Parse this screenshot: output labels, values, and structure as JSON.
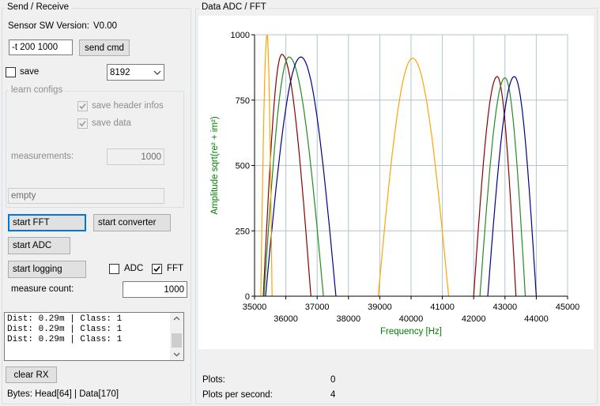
{
  "send_receive": {
    "group_title": "Send / Receive",
    "sensor_sw_label": "Sensor SW Version:",
    "sensor_sw_value": "V0.00",
    "cmd_input_value": "-t 200 1000",
    "send_cmd_label": "send cmd",
    "save_label": "save",
    "save_checked": false,
    "buffer_select_value": "8192",
    "learn_configs": {
      "title": "learn configs",
      "save_header_label": "save header infos",
      "save_header_checked": true,
      "save_data_label": "save data",
      "save_data_checked": true,
      "measurements_label": "measurements:",
      "measurements_value": "1000",
      "status_field_value": "empty"
    },
    "start_fft_label": "start FFT",
    "start_converter_label": "start converter",
    "start_adc_label": "start ADC",
    "start_logging_label": "start logging",
    "adc_label": "ADC",
    "adc_checked": false,
    "fft_label": "FFT",
    "fft_checked": true,
    "measure_count_label": "measure count:",
    "measure_count_value": "1000",
    "rx_lines": [
      "Dist: 0.29m | Class: 1",
      "Dist: 0.29m | Class: 1",
      "Dist: 0.29m | Class: 1"
    ],
    "clear_rx_label": "clear RX",
    "bytes_status": "Bytes: Head[64] | Data[170]"
  },
  "data_panel": {
    "group_title": "Data ADC / FFT",
    "plots_label": "Plots:",
    "plots_value": "0",
    "plots_per_second_label": "Plots per second:",
    "plots_per_second_value": "4"
  },
  "chart_data": {
    "type": "line",
    "xlabel": "Frequency [Hz]",
    "ylabel": "Amplitude sqrt(re² + im²)",
    "xlim": [
      35000,
      45000
    ],
    "ylim": [
      0,
      1000
    ],
    "x_ticks_top": [
      "35000",
      "37000",
      "39000",
      "41000",
      "43000",
      "45000"
    ],
    "x_ticks_bottom": [
      "36000",
      "38000",
      "40000",
      "42000",
      "44000"
    ],
    "y_ticks": [
      "0",
      "250",
      "500",
      "750",
      "1000"
    ],
    "grid": true,
    "axis_label_color": "#008000",
    "series": [
      {
        "color": "#8b0000",
        "peaks": [
          {
            "x": [
              35280,
              35870,
              36800
            ],
            "y": 925
          },
          {
            "x": [
              42000,
              42750,
              43350
            ],
            "y": 840
          }
        ]
      },
      {
        "color": "#228b22",
        "peaks": [
          {
            "x": [
              35300,
              36100,
              37200
            ],
            "y": 915
          },
          {
            "x": [
              42200,
              43000,
              43650
            ],
            "y": 835
          }
        ]
      },
      {
        "color": "#00008b",
        "peaks": [
          {
            "x": [
              35350,
              36480,
              37600
            ],
            "y": 915
          },
          {
            "x": [
              42450,
              43300,
              44000
            ],
            "y": 840
          }
        ]
      },
      {
        "color": "#ffa500",
        "peaks": [
          {
            "x": [
              35200,
              35400,
              35560
            ],
            "y": 1000
          },
          {
            "x": [
              38950,
              40050,
              41200
            ],
            "y": 910
          }
        ]
      }
    ]
  }
}
